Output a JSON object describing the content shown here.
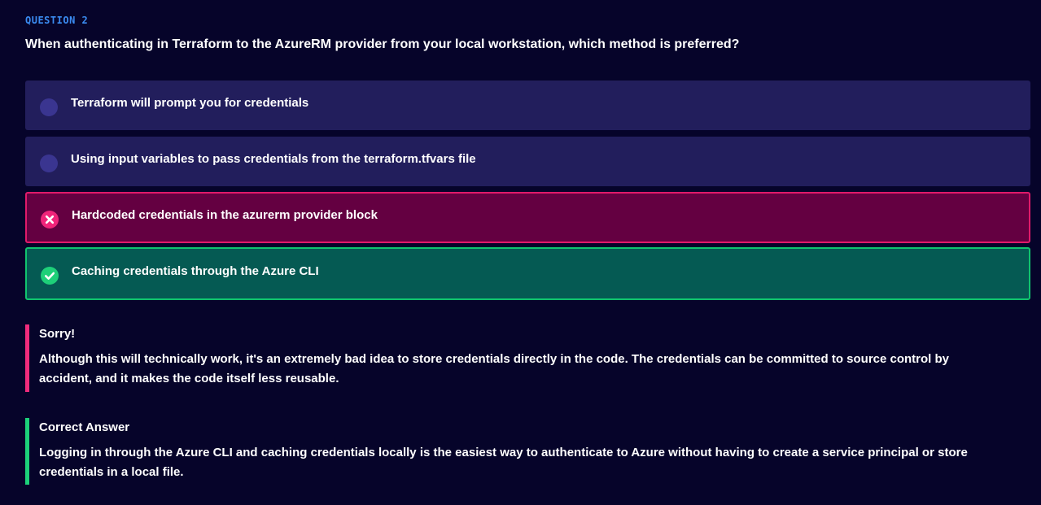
{
  "question": {
    "number_label": "QUESTION 2",
    "text": "When authenticating in Terraform to the AzureRM provider from your local workstation, which method is preferred?"
  },
  "options": [
    {
      "label": "Terraform will prompt you for credentials",
      "state": "unselected"
    },
    {
      "label": "Using input variables to pass credentials from the terraform.tfvars file",
      "state": "unselected"
    },
    {
      "label": "Hardcoded credentials in the azurerm provider block",
      "state": "wrong"
    },
    {
      "label": "Caching credentials through the Azure CLI",
      "state": "correct"
    }
  ],
  "feedback": {
    "sorry": {
      "title": "Sorry!",
      "body": "Although this will technically work, it's an extremely bad idea to store credentials directly in the code. The credentials can be committed to source control by accident, and it makes the code itself less reusable."
    },
    "correct": {
      "title": "Correct Answer",
      "body": "Logging in through the Azure CLI and caching credentials locally is the easiest way to authenticate to Azure without having to create a service principal or store credentials in a local file."
    }
  },
  "colors": {
    "background": "#06042a",
    "option_bg": "#221e5c",
    "wrong_bg": "#640041",
    "wrong_accent": "#e01a6a",
    "correct_bg": "#055a53",
    "correct_accent": "#10c46e",
    "question_label": "#3b8cf2"
  },
  "icons": {
    "wrong": "x-circle-icon",
    "correct": "check-circle-icon",
    "unselected": "radio-empty-icon"
  }
}
